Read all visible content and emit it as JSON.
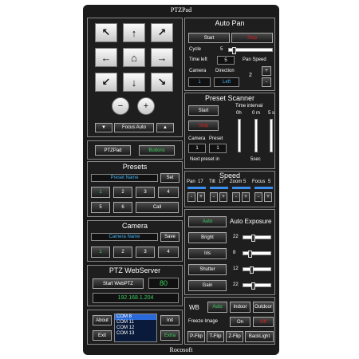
{
  "window": {
    "title": "PTZPad",
    "footer": "Rocosoft"
  },
  "ptzpad": {
    "zoom_out_label": "−",
    "zoom_in_label": "+",
    "focus_down": "▼",
    "focus_auto": "Focus Auto",
    "focus_up": "▲",
    "tab_ptzpad": "PTZPad",
    "tab_buttons": "Buttons"
  },
  "auto_pan": {
    "title": "Auto Pan",
    "start": "Start",
    "stop": "Stop",
    "cycle_label": "Cycle",
    "cycle_value": "5",
    "time_left_label": "Time left",
    "time_left_value": "5",
    "pan_speed_label": "Pan Speed",
    "camera_label": "Camera",
    "camera_value": "1",
    "direction_label": "Direction",
    "direction_value": "Left",
    "speed_value": "2",
    "plus": "+",
    "minus": "-"
  },
  "preset_scanner": {
    "title": "Preset Scanner",
    "start": "Start",
    "stop": "Stop",
    "time_interval": "Time interval",
    "col_0h": "0h",
    "col_0m": "0 m",
    "col_5s": "5 s",
    "camera_label": "Camera",
    "preset_label": "Preset",
    "camera_value": "1",
    "preset_value": "1",
    "next_preset": "Next preset in",
    "next_time": "5sec"
  },
  "presets": {
    "title": "Presets",
    "name_placeholder": "Preset Name",
    "set": "Set",
    "buttons": [
      "1",
      "2",
      "3",
      "4",
      "5",
      "6"
    ],
    "call": "Call"
  },
  "speed": {
    "title": "Speed",
    "pan_label": "Pan",
    "pan_value": "17",
    "tilt_label": "Tilt",
    "tilt_value": "17",
    "zoom_label": "Zoom",
    "zoom_value": "5",
    "focus_label": "Focus",
    "focus_value": "5",
    "minus": "-",
    "plus": "+"
  },
  "camera": {
    "title": "Camera",
    "name_placeholder": "Camera Name",
    "save": "Save",
    "buttons": [
      "1",
      "2",
      "3",
      "4"
    ]
  },
  "exposure": {
    "title": "Auto Exposure",
    "auto": "Auto",
    "bright": "Bright",
    "iris": "Iris",
    "shutter": "Shutter",
    "gain": "Gain",
    "bright_value": "22",
    "iris_value": "8",
    "shutter_value": "12",
    "gain_value": "22"
  },
  "webserver": {
    "title": "PTZ WebServer",
    "start": "Start WebPTZ",
    "port": "80",
    "ip": "192.168.1.204"
  },
  "wb": {
    "label": "WB",
    "auto": "Auto",
    "indoor": "Indoor",
    "outdoor": "Outdoor",
    "freeze_label": "Freeze Image",
    "on": "On",
    "off": "Off",
    "pflip": "P-Flip",
    "tflip": "T-Flip",
    "zflip": "Z-Flip",
    "backlight": "BackLight"
  },
  "bottom": {
    "about": "About",
    "exit": "Exit",
    "init": "Init",
    "extra": "Extra",
    "com_ports": [
      "COM 8",
      "COM 11",
      "COM 12",
      "COM 13"
    ]
  },
  "colors": {
    "accent_red": "#e02020",
    "accent_green": "#3cd060",
    "accent_blue": "#3cb0f0"
  }
}
